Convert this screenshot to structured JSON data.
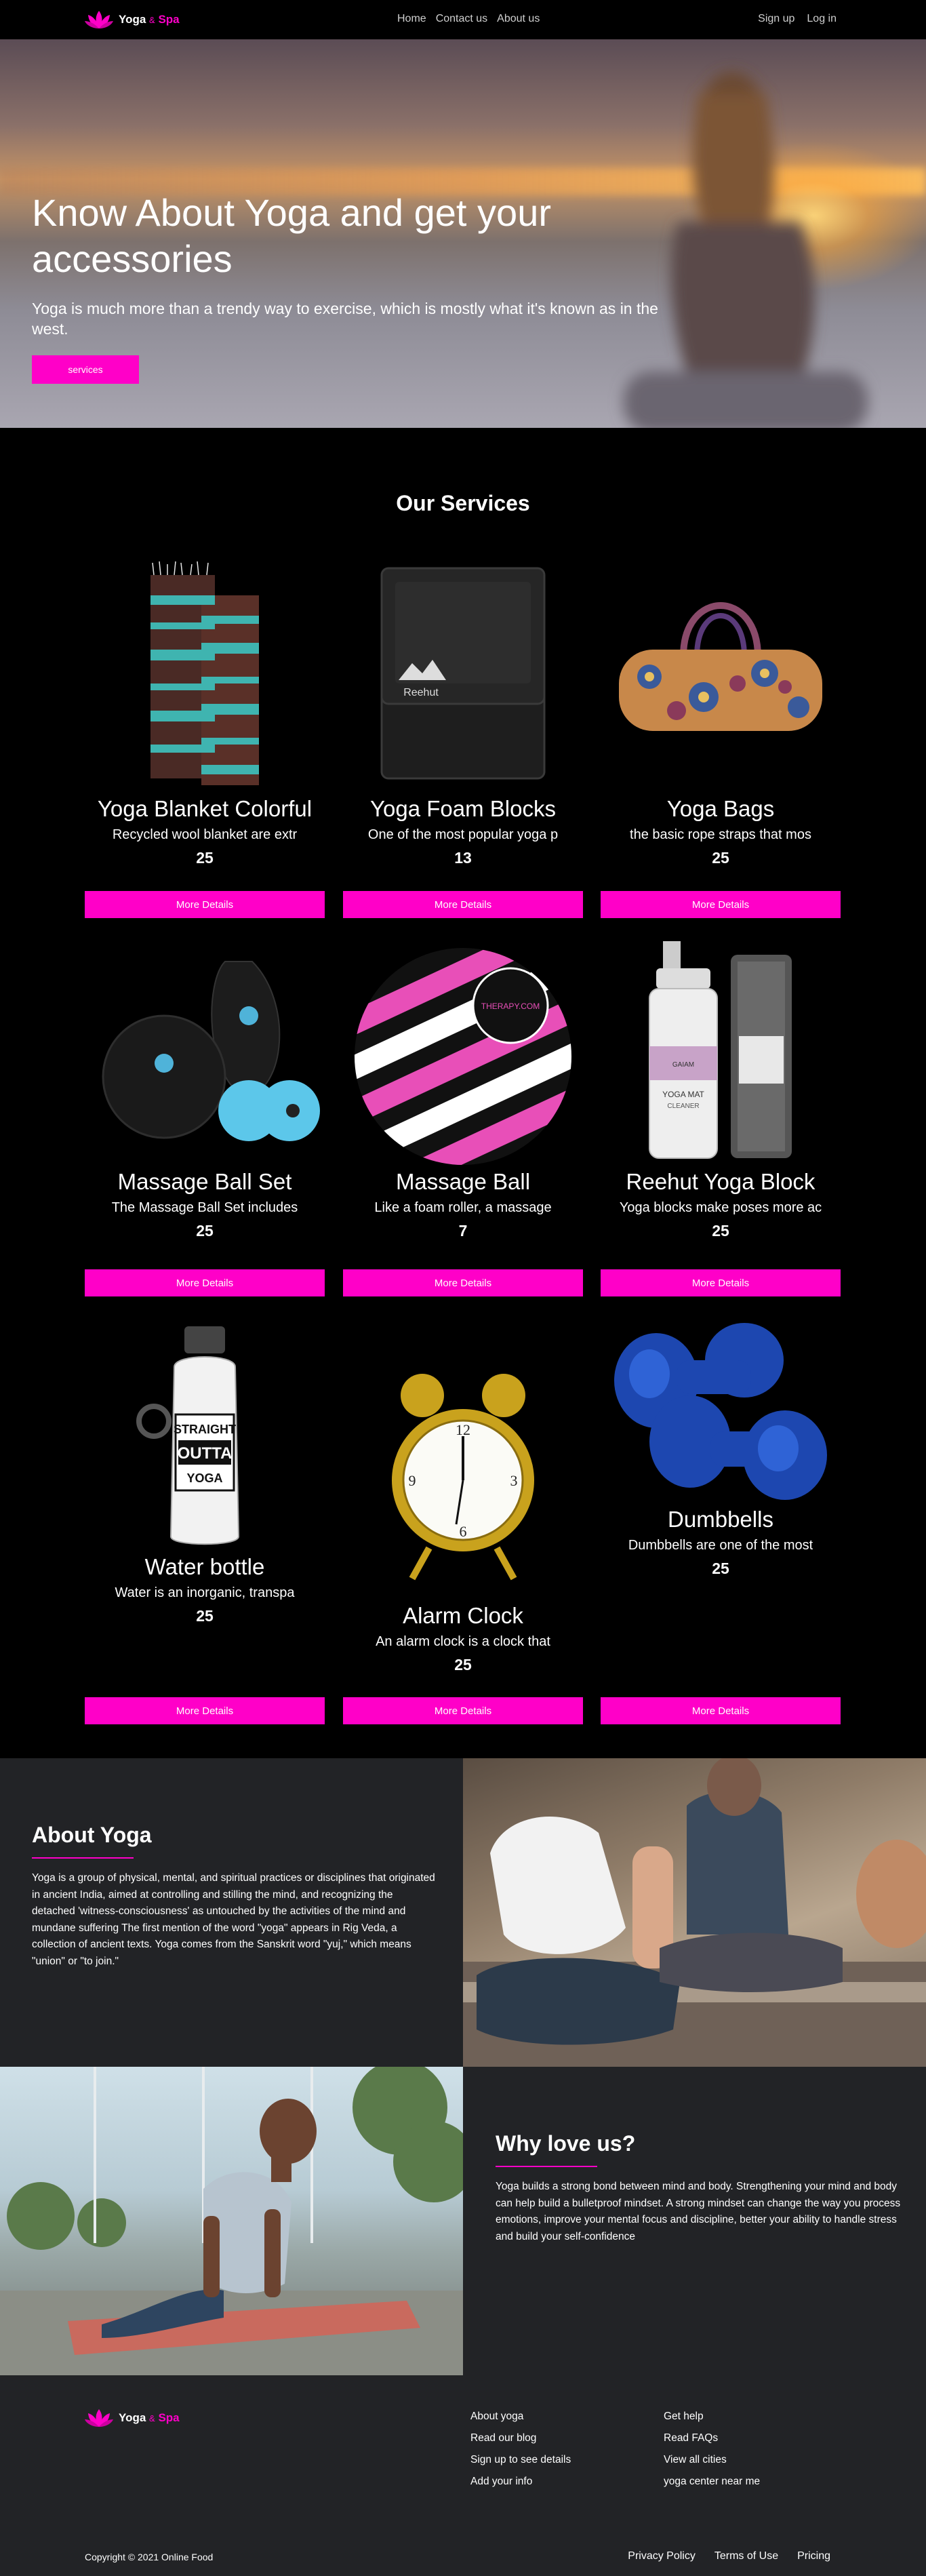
{
  "nav": {
    "brand_main": "Yoga",
    "brand_amp": "&",
    "brand_spa": "Spa",
    "links": [
      "Home",
      "Contact us",
      "About us"
    ],
    "signup": "Sign up",
    "login": "Log in"
  },
  "hero": {
    "title": "Know About Yoga and get your accessories",
    "subtitle": "Yoga is much more than a trendy way to exercise, which is mostly what it's known as in the west.",
    "button": "services"
  },
  "services": {
    "title": "Our Services",
    "button_label": "More Details",
    "items": [
      {
        "name": "Yoga Blanket Colorful",
        "desc": "Recycled wool blanket are extr",
        "price": "25"
      },
      {
        "name": "Yoga Foam Blocks",
        "desc": "One of the most popular yoga p",
        "price": "13"
      },
      {
        "name": "Yoga Bags",
        "desc": "the basic rope straps that mos",
        "price": "25"
      },
      {
        "name": "Massage Ball Set",
        "desc": "The Massage Ball Set includes",
        "price": "25"
      },
      {
        "name": "Massage Ball",
        "desc": "Like a foam roller, a massage",
        "price": "7"
      },
      {
        "name": "Reehut Yoga Block",
        "desc": "Yoga blocks make poses more ac",
        "price": "25"
      },
      {
        "name": "Water bottle",
        "desc": "Water is an inorganic, transpa",
        "price": "25"
      },
      {
        "name": "Alarm Clock",
        "desc": "An alarm clock is a clock that",
        "price": "25"
      },
      {
        "name": "Dumbbells",
        "desc": "Dumbbells are one of the most",
        "price": "25"
      }
    ],
    "image_text": {
      "block_brand": "Reehut",
      "ball_brand": "THERAPY.COM",
      "bottle_lines": [
        "STRAIGHT",
        "OUTTA",
        "YOGA"
      ],
      "cleaner_brand": "GAIAM",
      "cleaner_title": "YOGA MAT",
      "cleaner_sub": "CLEANER"
    }
  },
  "about": {
    "title": "About Yoga",
    "text": "Yoga is a group of physical, mental, and spiritual practices or disciplines that originated in ancient India, aimed at controlling and stilling the mind, and recognizing the detached 'witness-consciousness' as untouched by the activities of the mind and mundane suffering The first mention of the word \"yoga\" appears in Rig Veda, a collection of ancient texts. Yoga comes from the Sanskrit word \"yuj,\" which means \"union\" or \"to join.\""
  },
  "why": {
    "title": "Why love us?",
    "text": "Yoga builds a strong bond between mind and body. Strengthening your mind and body can help build a bulletproof mindset. A strong mindset can change the way you process emotions, improve your mental focus and discipline, better your ability to handle stress and build your self-confidence"
  },
  "footer": {
    "col1": [
      "About yoga",
      "Read our blog",
      "Sign up to see details",
      "Add your info"
    ],
    "col2": [
      "Get help",
      "Read FAQs",
      "View all cities",
      "yoga center near me"
    ],
    "copyright": "Copyright © 2021 Online Food",
    "legal": [
      "Privacy Policy",
      "Terms of Use",
      "Pricing"
    ]
  },
  "colors": {
    "accent": "#ff00c8",
    "panel": "#222326",
    "background": "#000000"
  }
}
